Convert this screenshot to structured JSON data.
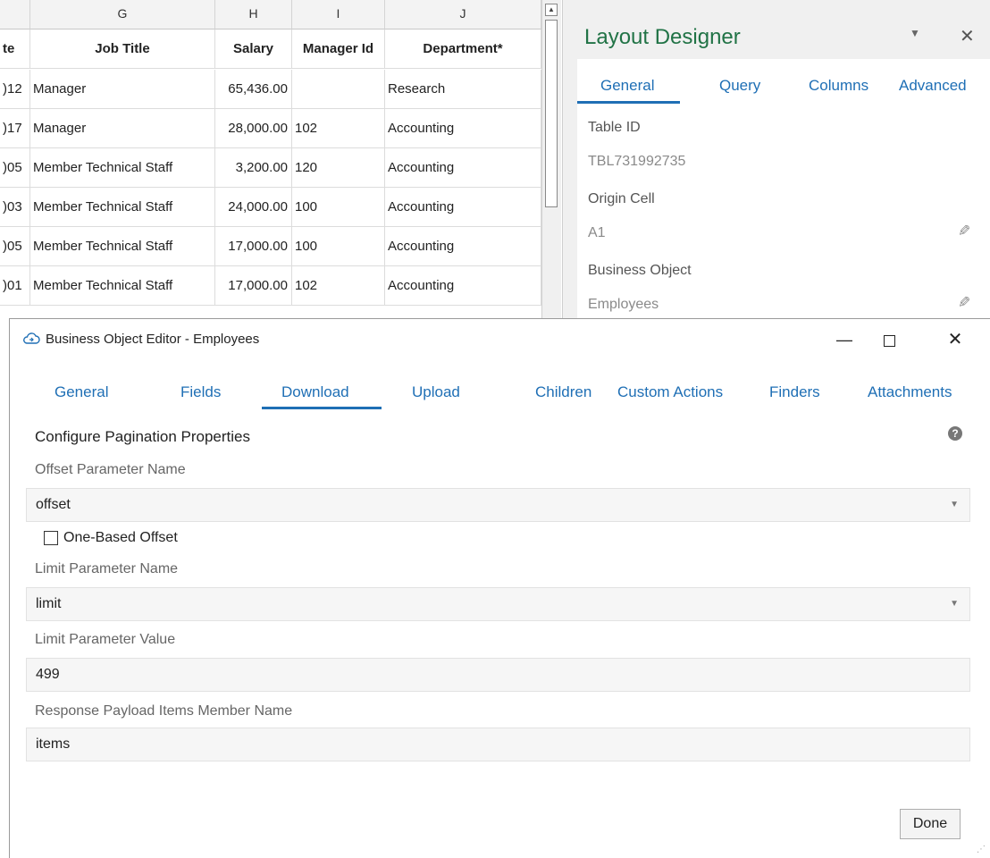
{
  "sheet": {
    "col_letters": [
      "G",
      "H",
      "I",
      "J"
    ],
    "headers": {
      "date_partial": "te",
      "job_title": "Job Title",
      "salary": "Salary",
      "manager_id": "Manager Id",
      "department": "Department*"
    },
    "rows": [
      {
        "date": ")12",
        "job": "Manager",
        "salary": "65,436.00",
        "mgr": "",
        "dept": "Research"
      },
      {
        "date": ")17",
        "job": "Manager",
        "salary": "28,000.00",
        "mgr": "102",
        "dept": "Accounting"
      },
      {
        "date": ")05",
        "job": "Member Technical Staff",
        "salary": "3,200.00",
        "mgr": "120",
        "dept": "Accounting"
      },
      {
        "date": ")03",
        "job": "Member Technical Staff",
        "salary": "24,000.00",
        "mgr": "100",
        "dept": "Accounting"
      },
      {
        "date": ")05",
        "job": "Member Technical Staff",
        "salary": "17,000.00",
        "mgr": "100",
        "dept": "Accounting"
      },
      {
        "date": ")01",
        "job": "Member Technical Staff",
        "salary": "17,000.00",
        "mgr": "102",
        "dept": "Accounting"
      }
    ]
  },
  "designer": {
    "title": "Layout Designer",
    "tabs": [
      "General",
      "Query",
      "Columns",
      "Advanced"
    ],
    "active_tab": "General",
    "table_id_label": "Table ID",
    "table_id_value": "TBL731992735",
    "origin_cell_label": "Origin Cell",
    "origin_cell_value": "A1",
    "business_object_label": "Business Object",
    "business_object_value": "Employees"
  },
  "dialog": {
    "title": "Business Object Editor - Employees",
    "tabs": [
      "General",
      "Fields",
      "Download",
      "Upload",
      "Children",
      "Custom Actions",
      "Finders",
      "Attachments"
    ],
    "active_tab": "Download",
    "section_title": "Configure Pagination Properties",
    "offset_param_label": "Offset Parameter Name",
    "offset_param_value": "offset",
    "one_based_label": "One-Based Offset",
    "one_based_checked": false,
    "limit_param_label": "Limit Parameter Name",
    "limit_param_value": "limit",
    "limit_value_label": "Limit Parameter Value",
    "limit_value": "499",
    "items_member_label": "Response Payload Items Member Name",
    "items_member_value": "items",
    "done_label": "Done"
  },
  "colors": {
    "accent_blue": "#1f6fb5",
    "excel_green": "#217346"
  }
}
